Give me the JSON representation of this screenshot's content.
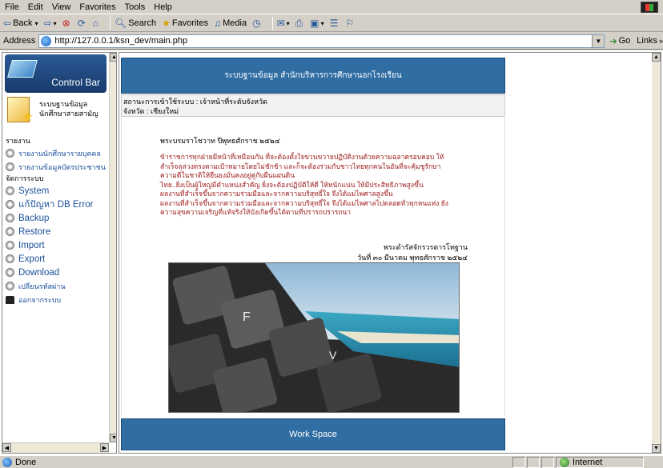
{
  "menubar": {
    "items": [
      "File",
      "Edit",
      "View",
      "Favorites",
      "Tools",
      "Help"
    ]
  },
  "toolbar": {
    "back": "Back",
    "search": "Search",
    "favorites": "Favorites",
    "media": "Media"
  },
  "address": {
    "label": "Address",
    "url": "http://127.0.0.1/ksn_dev/main.php",
    "go": "Go",
    "links": "Links"
  },
  "left": {
    "control_bar": "Control Bar",
    "db_label_1": "ระบบฐานข้อมูล",
    "db_label_2": "นักศึกษาสายสามัญ",
    "report_header": "รายงาน",
    "report_items": [
      "รายงานนักศึกษารายบุคคล",
      "รายงานข้อมูลบัตรประชาชน"
    ],
    "manage_header": "จัดการระบบ",
    "manage_items": [
      "System",
      "แก้ปัญหา DB Error",
      "Backup",
      "Restore",
      "Import",
      "Export",
      "Download",
      "เปลี่ยนรหัสผ่าน"
    ],
    "logout": "ออกจากระบบ"
  },
  "right": {
    "banner": "ระบบฐานข้อมูล สำนักบริหารการศึกษานอกโรงเรียน",
    "status_line1": "สถานะการเข้าใช้ระบบ : เจ้าหน้าที่ระดับจังหวัด",
    "status_line2": "จังหวัด : เชียงใหม่",
    "motto_title": "พระบรมราโชวาท ปีพุทธศักราช ๒๕๒๔",
    "motto_lines": [
      "ข้าราชการทุกฝ่ายมีหน้าที่เหมือนกัน ที่จะต้องตั้งใจขวนขวายปฏิบัติงานด้วยความฉลาดรอบคอบ ให้",
      "สำเร็จลุล่วงตรงตามเป้าหมายโดยไม่ชักช้า และก็จะต้องร่วมกับชาวไทยทุกคนในอันที่จะคุ้มชูรักษา",
      "ความดีในชาติให้ยืนยงมั่นคงอยู่คู่กับผืนแผ่นดิน",
      "ไทย..ยิ่งเป็นผู้ใหญ่มีตำแหน่งสำคัญ ยิ่งจะต้องปฏิบัติให้ดี ให้หนักแน่น ให้มีประสิทธิภาพสูงขึ้น",
      "ผลงานที่สำเร็จขึ้นจากความร่วมมือและจากความบริสุทธิ์ใจ จึงได้แม่ไพศาลสูงขึ้น",
      "ผลงานที่สำเร็จขึ้นจากความร่วมมือและจากความบริสุทธิ์ใจ จึงได้แม่ไพศาลไปตลอดทั่วทุกหนแห่ง ยัง",
      "ความสุขความเจริญที่แท้จริงให้บังเกิดขึ้นได้ตามที่ปรารถปรารถนา"
    ],
    "sign_1": "พระดำรัสจักรวรดารโทฐาน",
    "sign_2": "วันที่ ๓๐ มีนาคม พุทธศักราช ๒๕๒๔",
    "workspace": "Work Space"
  },
  "status": {
    "done": "Done",
    "zone": "Internet"
  },
  "icons": {
    "back": "back-arrow-icon",
    "forward": "forward-arrow-icon",
    "stop": "stop-icon",
    "refresh": "refresh-icon",
    "home": "home-icon",
    "search": "search-icon",
    "favorites": "favorites-star-icon",
    "media": "media-icon",
    "history": "history-icon",
    "mail": "mail-icon",
    "print": "print-icon",
    "edit": "edit-icon"
  }
}
